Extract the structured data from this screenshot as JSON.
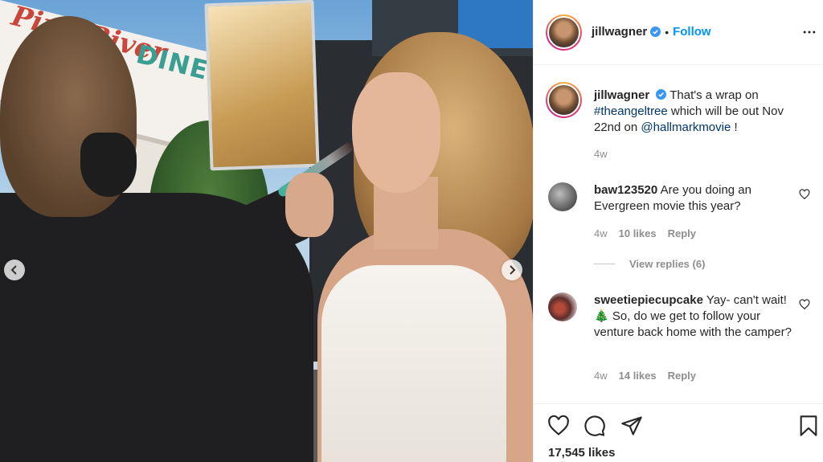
{
  "photo": {
    "sign_text_1": "Pine River",
    "sign_text_2": "DINER"
  },
  "post": {
    "username": "jillwagner",
    "follow_label": "Follow",
    "separator": "•",
    "caption": {
      "text_1": "That's a wrap on",
      "hashtag": "#theangeltree",
      "text_2": "which will be out Nov 22nd on",
      "mention": "@hallmarkmovie",
      "text_3": "!"
    },
    "time": "4w",
    "likes": "17,545 likes"
  },
  "comments": [
    {
      "username": "baw123520",
      "text": "Are you doing an Evergreen movie this year?",
      "time": "4w",
      "likes": "10 likes",
      "reply_label": "Reply",
      "view_replies": "View replies (6)"
    },
    {
      "username": "sweetiepiecupcake",
      "text_1": "Yay- can't wait!",
      "emoji": "🎄",
      "text_2": "So, do we get to follow your venture back home with the camper?",
      "time": "4w",
      "likes": "14 likes",
      "reply_label": "Reply"
    }
  ],
  "colors": {
    "accent": "#0095f6",
    "link": "#00376b",
    "muted": "#8e8e8e",
    "text": "#262626"
  },
  "icons": [
    "verified-badge-icon",
    "more-options-icon",
    "heart-icon",
    "comment-icon",
    "share-icon",
    "bookmark-icon",
    "chevron-left-icon",
    "chevron-right-icon"
  ]
}
